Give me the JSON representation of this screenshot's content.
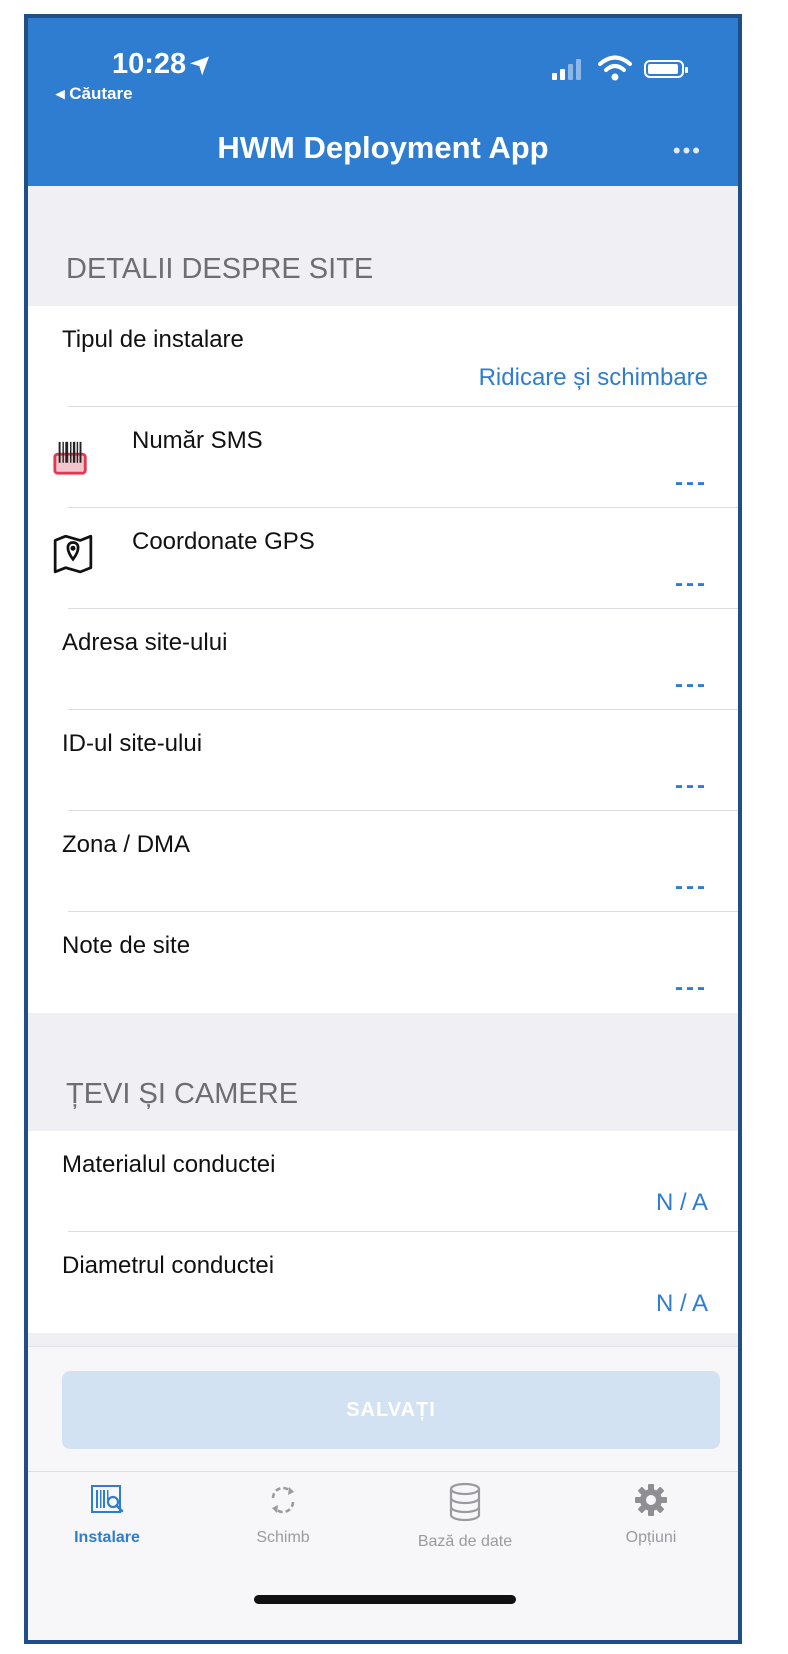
{
  "status_bar": {
    "time": "10:28",
    "back_label": "◂ Căutare"
  },
  "header": {
    "title": "HWM Deployment App",
    "more_label": "•••"
  },
  "sections": {
    "site": {
      "title": "DETALII DESPRE SITE",
      "rows": [
        {
          "label": "Tipul de instalare",
          "value": "Ridicare și schimbare"
        },
        {
          "label": "Număr SMS",
          "value": "---"
        },
        {
          "label": "Coordonate GPS",
          "value": "---"
        },
        {
          "label": "Adresa site-ului",
          "value": "---"
        },
        {
          "label": "ID-ul site-ului",
          "value": "---"
        },
        {
          "label": "Zona / DMA",
          "value": "---"
        },
        {
          "label": "Note de site",
          "value": "---"
        }
      ]
    },
    "pipes": {
      "title": "ȚEVI ȘI CAMERE",
      "rows": [
        {
          "label": "Materialul conductei",
          "value": "N / A"
        },
        {
          "label": "Diametrul conductei",
          "value": "N / A"
        }
      ]
    }
  },
  "save_label": "SALVAȚI",
  "tabs": [
    {
      "label": "Instalare",
      "icon": "barcode-scan-icon",
      "active": true
    },
    {
      "label": "Schimb",
      "icon": "sync-icon",
      "active": false
    },
    {
      "label": "Bază de date",
      "icon": "database-icon",
      "active": false
    },
    {
      "label": "Opțiuni",
      "icon": "gear-icon",
      "active": false
    }
  ],
  "colors": {
    "accent": "#2f7dd1",
    "header_bg": "#2f7dd1",
    "save_disabled": "#d3e2f3",
    "frame_border": "#1f4f86"
  }
}
